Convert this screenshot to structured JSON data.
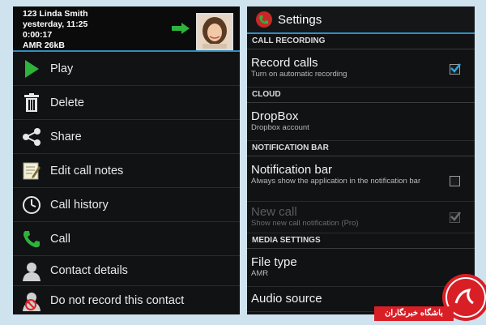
{
  "call": {
    "line1": "123  Linda Smith",
    "line2": "yesterday, 11:25",
    "line3": "0:00:17",
    "line4": "AMR  26kB"
  },
  "menu": [
    {
      "label": "Play",
      "icon": "play-icon"
    },
    {
      "label": "Delete",
      "icon": "trash-icon"
    },
    {
      "label": "Share",
      "icon": "share-icon"
    },
    {
      "label": "Edit call notes",
      "icon": "note-icon"
    },
    {
      "label": "Call history",
      "icon": "clock-icon"
    },
    {
      "label": "Call",
      "icon": "phone-icon"
    },
    {
      "label": "Contact details",
      "icon": "person-icon"
    },
    {
      "label": "Do not record this contact",
      "icon": "person-blocked-icon"
    }
  ],
  "settings": {
    "title": "Settings",
    "sections": [
      {
        "header": "CALL RECORDING"
      },
      {
        "header": "CLOUD"
      },
      {
        "header": "NOTIFICATION BAR"
      },
      {
        "header": "MEDIA SETTINGS"
      }
    ],
    "prefs": {
      "record_calls": {
        "title": "Record calls",
        "summary": "Turn on automatic recording",
        "checked": true
      },
      "dropbox": {
        "title": "DropBox",
        "summary": "Dropbox account"
      },
      "notification_bar": {
        "title": "Notification bar",
        "summary": "Always show the application in the notification bar",
        "checked": false
      },
      "new_call": {
        "title": "New call",
        "summary": "Show new call notification (Pro)",
        "checked": true,
        "enabled": false
      },
      "file_type": {
        "title": "File type",
        "summary": "AMR"
      },
      "audio_source": {
        "title": "Audio source"
      }
    }
  },
  "watermark": {
    "text": "باشگاه خبرنگاران"
  },
  "colors": {
    "accent": "#2f8fbf",
    "check": "#29a6df",
    "play": "#2db43a",
    "phone": "#2db43a",
    "watermark": "#d91f26"
  }
}
